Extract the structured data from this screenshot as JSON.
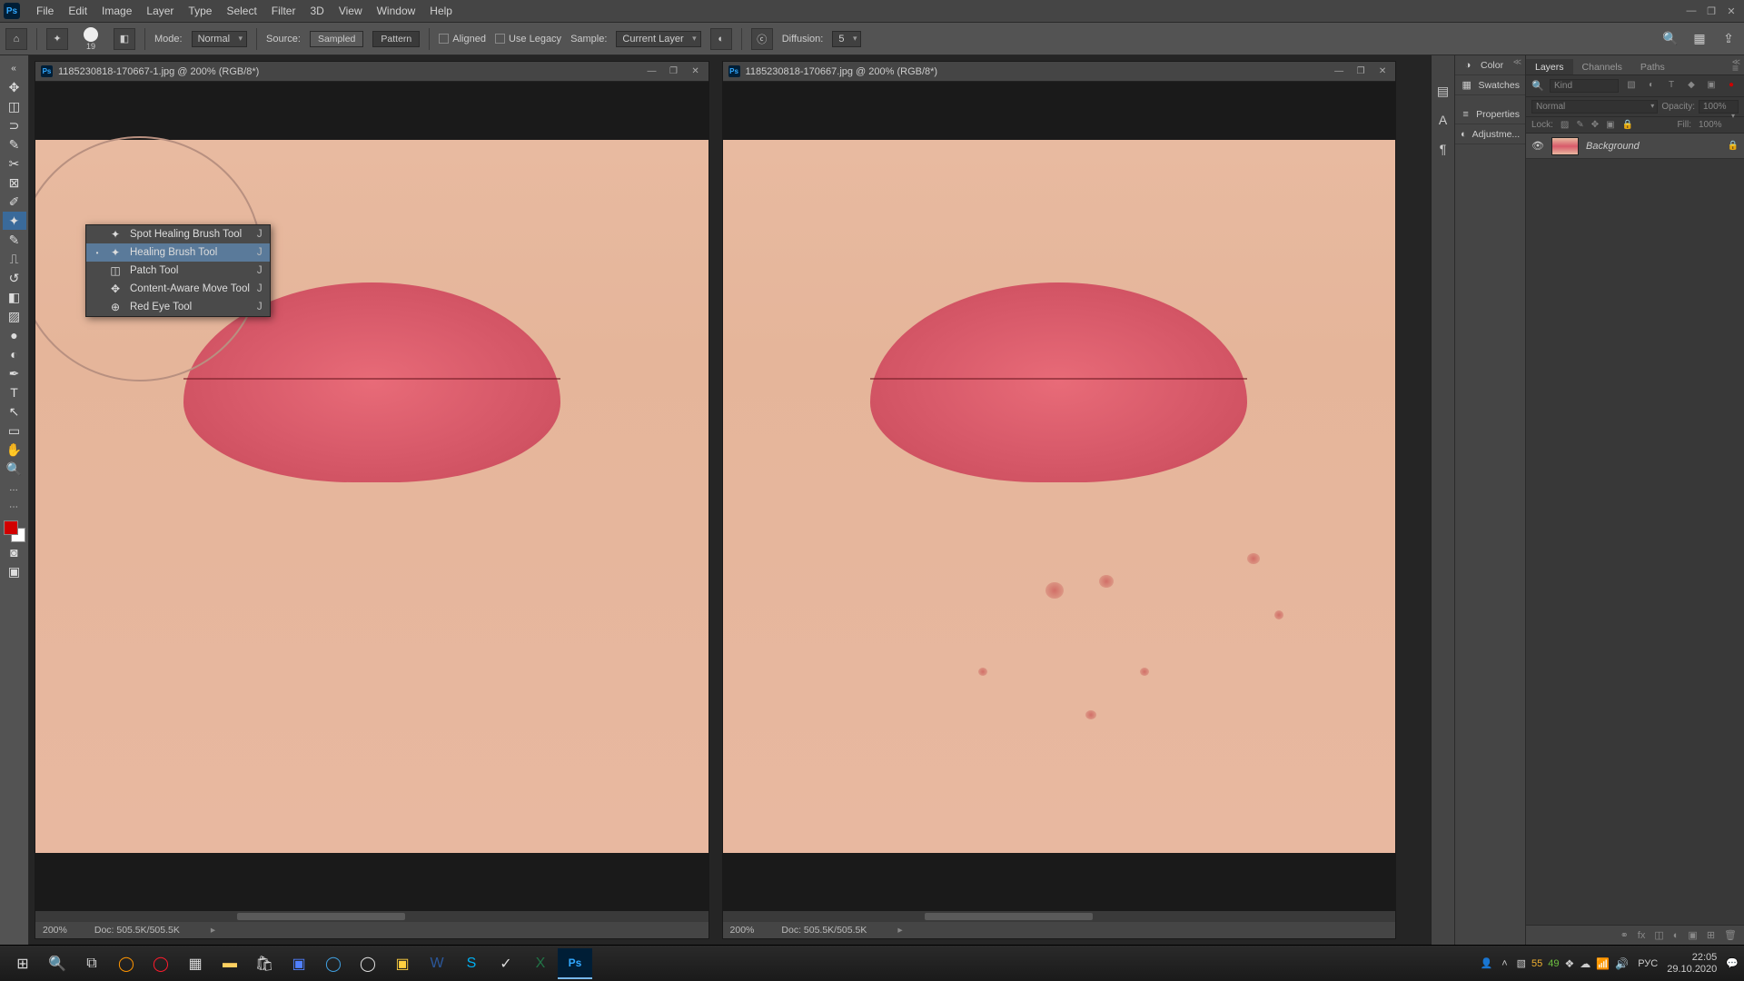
{
  "menubar": {
    "items": [
      "File",
      "Edit",
      "Image",
      "Layer",
      "Type",
      "Select",
      "Filter",
      "3D",
      "View",
      "Window",
      "Help"
    ]
  },
  "optionsbar": {
    "brush_size": "19",
    "mode_label": "Mode:",
    "mode_value": "Normal",
    "source_label": "Source:",
    "source_sampled": "Sampled",
    "source_pattern": "Pattern",
    "aligned": "Aligned",
    "legacy": "Use Legacy",
    "sample_label": "Sample:",
    "sample_value": "Current Layer",
    "diffusion_label": "Diffusion:",
    "diffusion_value": "5"
  },
  "documents": [
    {
      "title": "1185230818-170667-1.jpg @ 200% (RGB/8*)",
      "zoom": "200%",
      "doc_info": "Doc: 505.5K/505.5K",
      "has_magnifier": true,
      "retouched": true
    },
    {
      "title": "1185230818-170667.jpg @ 200% (RGB/8*)",
      "zoom": "200%",
      "doc_info": "Doc: 505.5K/505.5K",
      "has_magnifier": false,
      "retouched": false
    }
  ],
  "tool_flyout": {
    "items": [
      {
        "label": "Spot Healing Brush Tool",
        "key": "J",
        "selected": false
      },
      {
        "label": "Healing Brush Tool",
        "key": "J",
        "selected": true
      },
      {
        "label": "Patch Tool",
        "key": "J",
        "selected": false
      },
      {
        "label": "Content-Aware Move Tool",
        "key": "J",
        "selected": false
      },
      {
        "label": "Red Eye Tool",
        "key": "J",
        "selected": false
      }
    ]
  },
  "right_panels": {
    "collapsed": [
      "Color",
      "Swatches",
      "Properties",
      "Adjustme..."
    ],
    "tabs": [
      "Layers",
      "Channels",
      "Paths"
    ],
    "active_tab": "Layers",
    "filter_placeholder": "Kind",
    "blend_mode": "Normal",
    "opacity_label": "Opacity:",
    "opacity_value": "100%",
    "lock_label": "Lock:",
    "fill_label": "Fill:",
    "fill_value": "100%",
    "layers": [
      {
        "name": "Background",
        "locked": true
      }
    ]
  },
  "taskbar": {
    "temp1": "55",
    "temp2": "49",
    "lang": "РУС",
    "time": "22:05",
    "date": "29.10.2020"
  }
}
